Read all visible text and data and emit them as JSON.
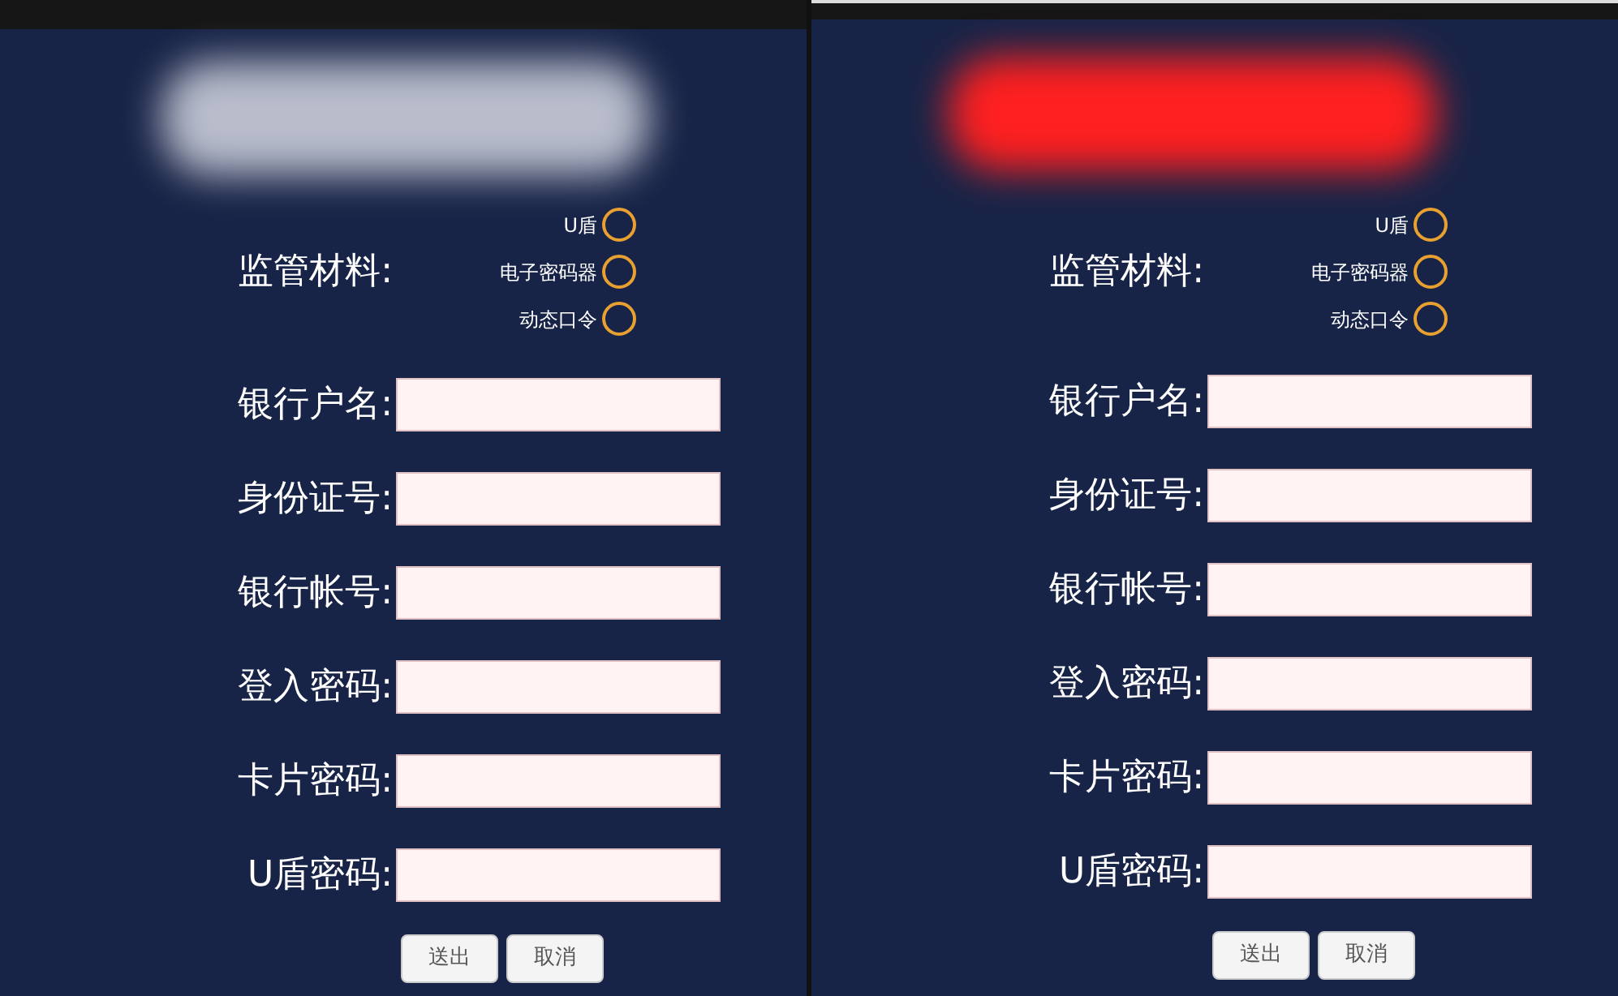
{
  "panels": [
    {
      "redaction": {
        "color": "#b8bccb"
      },
      "material_label": "监管材料:",
      "material_options": [
        {
          "label": "U盾",
          "selected": false
        },
        {
          "label": "电子密码器",
          "selected": false
        },
        {
          "label": "动态口令",
          "selected": false
        }
      ],
      "fields": [
        {
          "label": "银行户名:"
        },
        {
          "label": "身份证号:"
        },
        {
          "label": "银行帐号:"
        },
        {
          "label": "登入密码:"
        },
        {
          "label": "卡片密码:"
        },
        {
          "label": "U盾密码:"
        }
      ],
      "buttons": [
        "送出",
        "取消"
      ]
    },
    {
      "redaction": {
        "color": "#ff2020"
      },
      "material_label": "监管材料:",
      "material_options": [
        {
          "label": "U盾",
          "selected": false
        },
        {
          "label": "电子密码器",
          "selected": false
        },
        {
          "label": "动态口令",
          "selected": false
        }
      ],
      "fields": [
        {
          "label": "银行户名:"
        },
        {
          "label": "身份证号:"
        },
        {
          "label": "银行帐号:"
        },
        {
          "label": "登入密码:"
        },
        {
          "label": "卡片密码:"
        },
        {
          "label": "U盾密码:"
        }
      ],
      "buttons": [
        "送出",
        "取消"
      ]
    }
  ]
}
